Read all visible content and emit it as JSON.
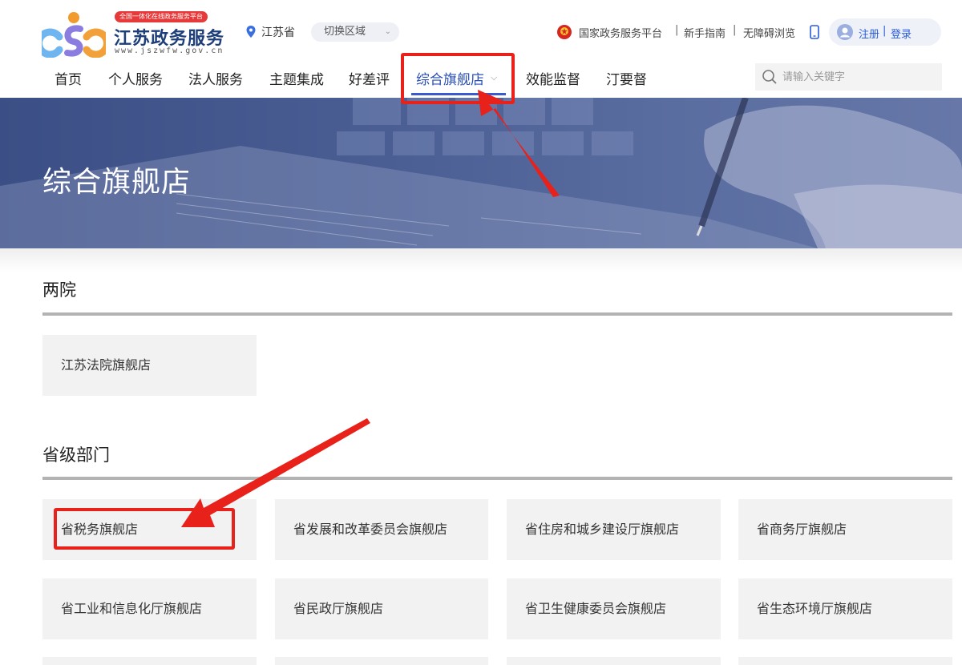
{
  "header": {
    "logo": {
      "badge": "全国一体化在线政务服务平台",
      "name": "江苏政务服务",
      "url": "www.jszwfw.gov.cn"
    },
    "region": {
      "current": "江苏省",
      "switch_label": "切换区域"
    },
    "top_links": {
      "national_platform": "国家政务服务平台",
      "guide": "新手指南",
      "accessible": "无障碍浏览",
      "register": "注册",
      "login": "登录"
    },
    "search": {
      "placeholder": "请输入关键字"
    }
  },
  "nav": {
    "items": [
      {
        "label": "首页"
      },
      {
        "label": "个人服务"
      },
      {
        "label": "法人服务"
      },
      {
        "label": "主题集成"
      },
      {
        "label": "好差评"
      },
      {
        "label": "综合旗舰店"
      },
      {
        "label": "效能监督"
      },
      {
        "label": "汀要督"
      }
    ],
    "active_index": 5
  },
  "banner": {
    "title": "综合旗舰店"
  },
  "sections": [
    {
      "title": "两院",
      "cards": [
        {
          "label": "江苏法院旗舰店"
        }
      ]
    },
    {
      "title": "省级部门",
      "cards": [
        {
          "label": "省税务旗舰店"
        },
        {
          "label": "省发展和改革委员会旗舰店"
        },
        {
          "label": "省住房和城乡建设厅旗舰店"
        },
        {
          "label": "省商务厅旗舰店"
        },
        {
          "label": "省工业和信息化厅旗舰店"
        },
        {
          "label": "省民政厅旗舰店"
        },
        {
          "label": "省卫生健康委员会旗舰店"
        },
        {
          "label": "省生态环境厅旗舰店"
        }
      ]
    }
  ],
  "colors": {
    "accent": "#2a4fb5",
    "annotation_red": "#e8211a",
    "card_bg": "#f2f2f2",
    "banner": "#4a5e94"
  },
  "icons": [
    "logo-mark",
    "location-pin-icon",
    "chevron-down-icon",
    "national-emblem-icon",
    "phone-icon",
    "user-avatar-icon",
    "search-icon"
  ]
}
